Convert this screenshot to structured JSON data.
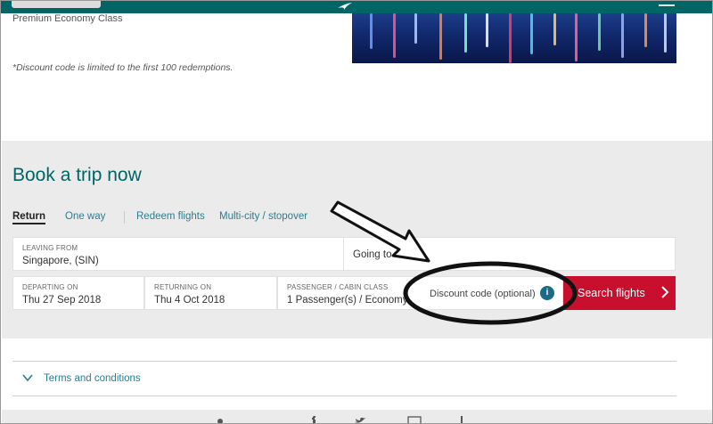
{
  "header": {
    "colors": {
      "bar": "#006564"
    },
    "icons": [
      "airline-logo-icon",
      "menu-icon"
    ]
  },
  "promo": {
    "line": "Premium Economy Class",
    "disclaimer": "*Discount code is limited to the first 100 redemptions."
  },
  "booking": {
    "title": "Book a trip now",
    "tabs": [
      {
        "label": "Return",
        "active": true
      },
      {
        "label": "One way",
        "active": false
      },
      {
        "label": "Redeem flights",
        "active": false
      },
      {
        "label": "Multi-city / stopover",
        "active": false
      }
    ],
    "leaving": {
      "label": "LEAVING FROM",
      "value": "Singapore, (SIN)"
    },
    "going": {
      "placeholder": "Going to"
    },
    "departing": {
      "label": "DEPARTING ON",
      "value": "Thu 27 Sep 2018"
    },
    "returning": {
      "label": "RETURNING ON",
      "value": "Thu 4 Oct 2018"
    },
    "passenger": {
      "label": "PASSENGER / CABIN CLASS",
      "value": "1 Passenger(s) / Economy"
    },
    "discount": {
      "label": "Discount code (optional)",
      "info_icon": "i"
    },
    "search_button": {
      "label": "Search flights"
    },
    "colors": {
      "accent": "#006564",
      "search": "#c8102e",
      "link": "#2a7d90"
    }
  },
  "terms": {
    "label": "Terms and conditions"
  }
}
